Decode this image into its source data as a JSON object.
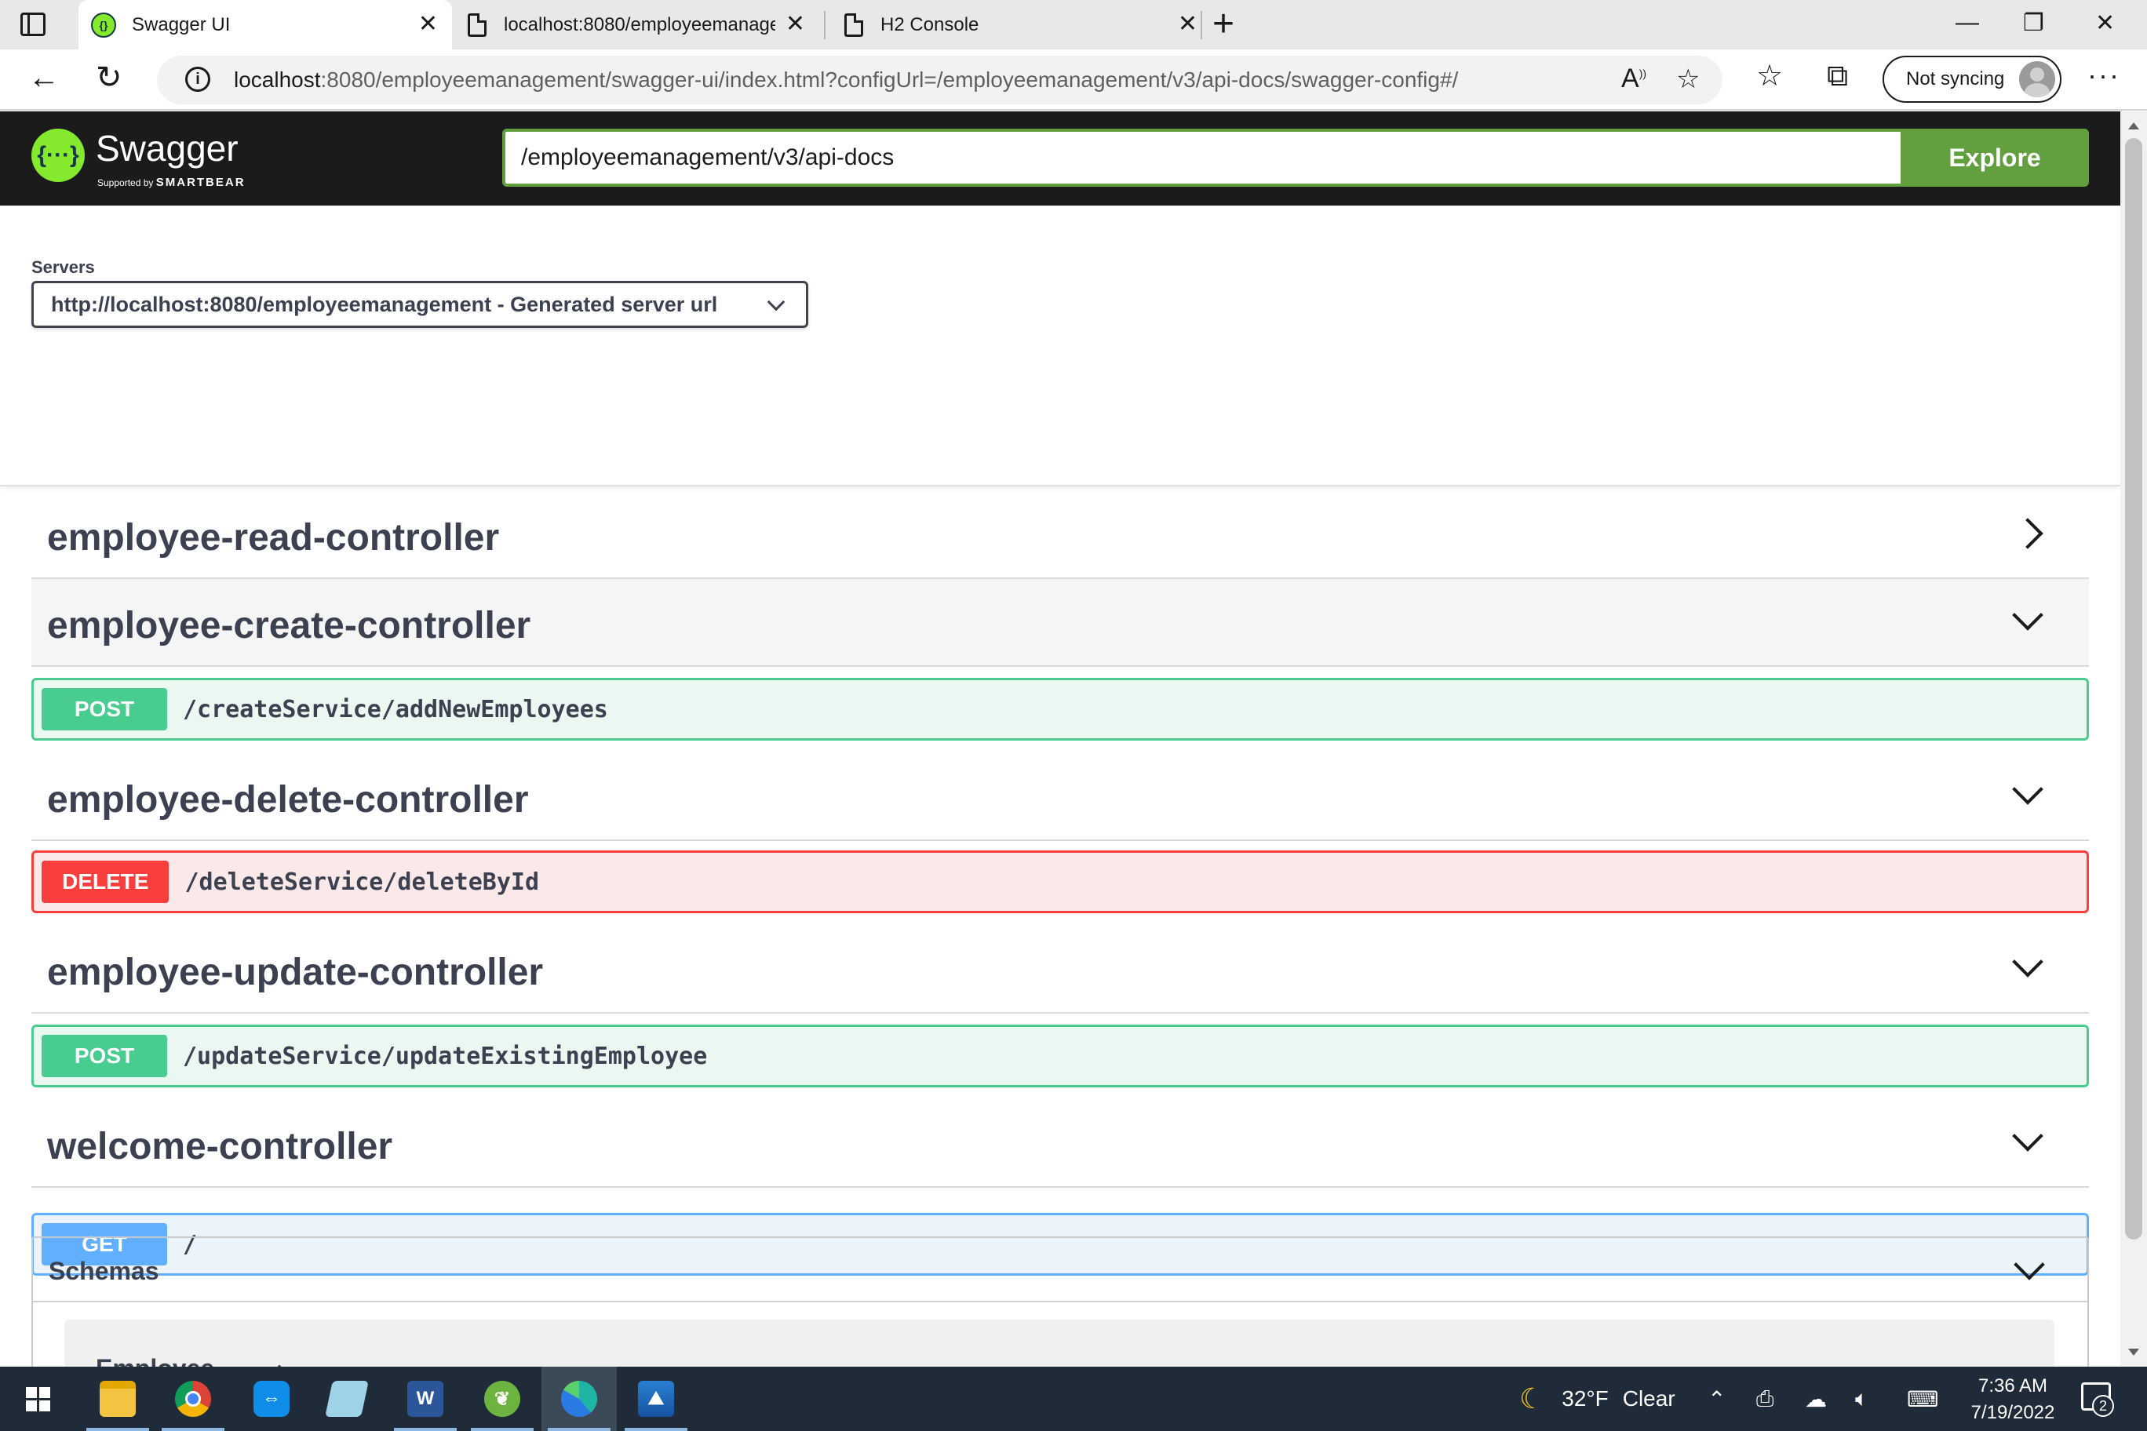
{
  "browser": {
    "tabs": [
      {
        "title": "Swagger UI",
        "icon": "swagger-favicon-icon",
        "active": true
      },
      {
        "title": "localhost:8080/employeemanage",
        "icon": "page-icon",
        "active": false
      },
      {
        "title": "H2 Console",
        "icon": "page-icon",
        "active": false
      }
    ],
    "close_glyph": "✕",
    "new_tab_glyph": "+",
    "window_controls": {
      "minimize": "—",
      "restore": "❐",
      "close": "✕"
    },
    "url": {
      "host": "localhost",
      "rest": ":8080/employeemanagement/swagger-ui/index.html?configUrl=/employeemanagement/v3/api-docs/swagger-config#/"
    },
    "sync_label": "Not syncing",
    "more_glyph": "···"
  },
  "swagger": {
    "logo_glyph": "{···}",
    "logo_text": "Swagger",
    "logo_sub_prefix": "Supported by",
    "logo_sub_brand": "SMARTBEAR",
    "spec_url": "/employeemanagement/v3/api-docs",
    "explore_label": "Explore",
    "servers_label": "Servers",
    "server_selected": "http://localhost:8080/employeemanagement - Generated server url",
    "controllers": [
      {
        "name": "employee-read-controller",
        "expanded": false,
        "operations": []
      },
      {
        "name": "employee-create-controller",
        "expanded": true,
        "operations": [
          {
            "method": "POST",
            "path": "/createService/addNewEmployees"
          }
        ]
      },
      {
        "name": "employee-delete-controller",
        "expanded": true,
        "operations": [
          {
            "method": "DELETE",
            "path": "/deleteService/deleteById"
          }
        ]
      },
      {
        "name": "employee-update-controller",
        "expanded": true,
        "operations": [
          {
            "method": "POST",
            "path": "/updateService/updateExistingEmployee"
          }
        ]
      },
      {
        "name": "welcome-controller",
        "expanded": true,
        "operations": [
          {
            "method": "GET",
            "path": "/"
          }
        ]
      }
    ],
    "schemas_title": "Schemas",
    "schemas": [
      {
        "name": "Employee"
      }
    ],
    "colors": {
      "post": "#49cc90",
      "delete": "#f93e3e",
      "get": "#61affe",
      "explore": "#62a03f",
      "topbar": "#1b1b1b"
    }
  },
  "taskbar": {
    "apps": [
      {
        "name": "file-explorer-icon"
      },
      {
        "name": "chrome-icon"
      },
      {
        "name": "teamviewer-icon"
      },
      {
        "name": "notepad-icon"
      },
      {
        "name": "word-icon",
        "label": "W"
      },
      {
        "name": "spring-tool-suite-icon"
      },
      {
        "name": "edge-icon"
      },
      {
        "name": "photos-icon"
      }
    ],
    "weather_temp": "32°F",
    "weather_text": "Clear",
    "time": "7:36 AM",
    "date": "7/19/2022",
    "notifications": "2"
  }
}
